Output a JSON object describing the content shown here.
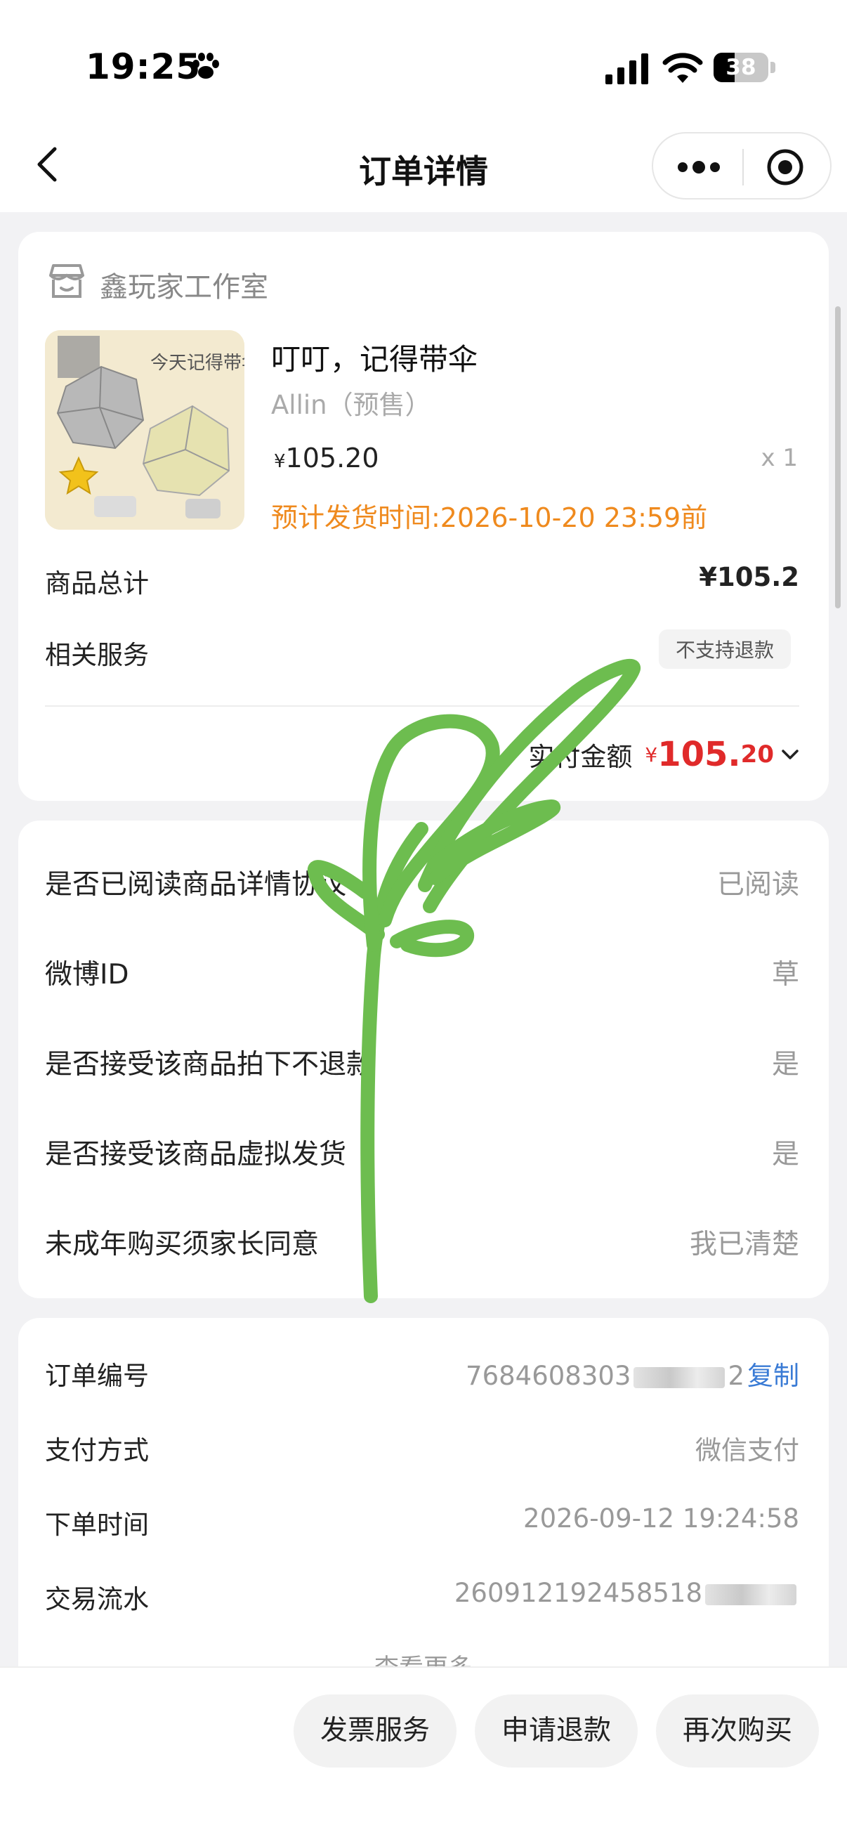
{
  "status_bar": {
    "time": "19:25",
    "battery": "38"
  },
  "nav": {
    "title": "订单详情"
  },
  "shop": {
    "name": "鑫玩家工作室"
  },
  "product": {
    "title": "叮叮，记得带伞",
    "sku": "Allin（预售）",
    "price_currency": "¥",
    "price": "105.20",
    "qty": "x 1",
    "ship_time": "预计发货时间:2026-10-20 23:59前",
    "image_text": "今天记得带伞~"
  },
  "summary": {
    "total_label": "商品总计",
    "total_value": "¥105.2",
    "service_label": "相关服务",
    "service_tag": "不支持退款",
    "paid_label": "实付金额",
    "paid_currency": "¥",
    "paid_int": "105.",
    "paid_dec": "20"
  },
  "questions": [
    {
      "label": "是否已阅读商品详情协议",
      "value": "已阅读"
    },
    {
      "label": "微博ID",
      "value": "草"
    },
    {
      "label": "是否接受该商品拍下不退款",
      "value": "是"
    },
    {
      "label": "是否接受该商品虚拟发货",
      "value": "是"
    },
    {
      "label": "未成年购买须家长同意",
      "value": "我已清楚"
    }
  ],
  "order_info": {
    "order_no_label": "订单编号",
    "order_no_prefix": "7684608303",
    "order_no_suffix": "2",
    "copy_label": "复制",
    "pay_method_label": "支付方式",
    "pay_method": "微信支付",
    "order_time_label": "下单时间",
    "order_time": "2026-09-12 19:24:58",
    "txn_label": "交易流水",
    "txn_prefix": "260912192458518",
    "see_more": "查看更多"
  },
  "actions": {
    "invoice": "发票服务",
    "refund": "申请退款",
    "rebuy": "再次购买"
  },
  "colors": {
    "accent_red": "#e02a2a",
    "ship_orange": "#ef8a1e",
    "link_blue": "#3a7bd5",
    "doodle_green": "#6dbd4f"
  }
}
